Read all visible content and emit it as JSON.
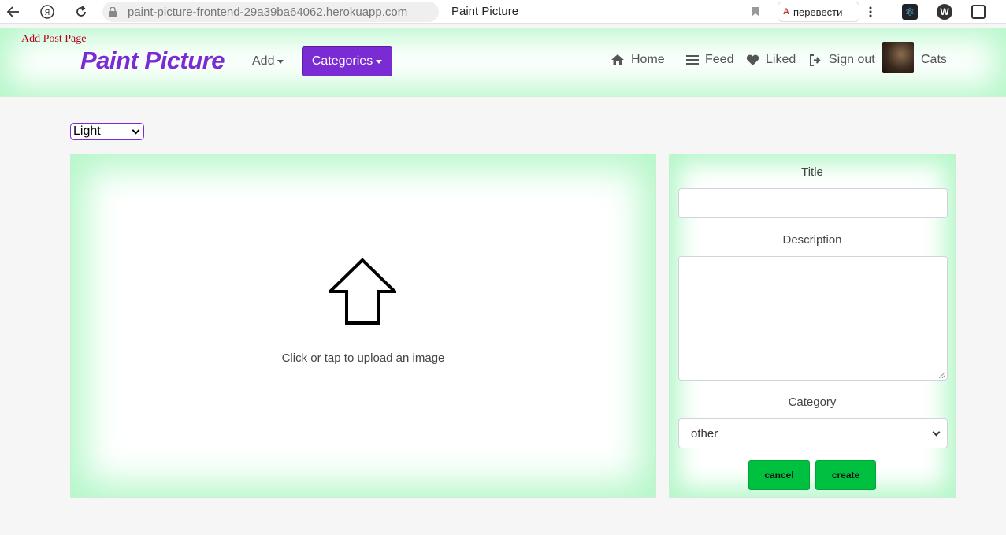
{
  "browser": {
    "url": "paint-picture-frontend-29a39ba64062.herokuapp.com",
    "tab_title": "Paint Picture",
    "translate_label": "перевести"
  },
  "header": {
    "page_label": "Add Post Page",
    "brand": "Paint Picture",
    "add_label": "Add",
    "categories_label": "Categories",
    "nav": {
      "home": "Home",
      "feed": "Feed",
      "liked": "Liked",
      "signout": "Sign out",
      "profile": "Cats"
    },
    "accent_color": "#7b2bd3"
  },
  "theme_select": {
    "selected": "Light"
  },
  "upload": {
    "text": "Click or tap to upload an image",
    "icon": "upload-arrow-icon"
  },
  "form": {
    "title_label": "Title",
    "title_value": "",
    "description_label": "Description",
    "description_value": "",
    "category_label": "Category",
    "category_selected": "other",
    "cancel_label": "cancel",
    "create_label": "create",
    "button_color": "#00c040"
  }
}
